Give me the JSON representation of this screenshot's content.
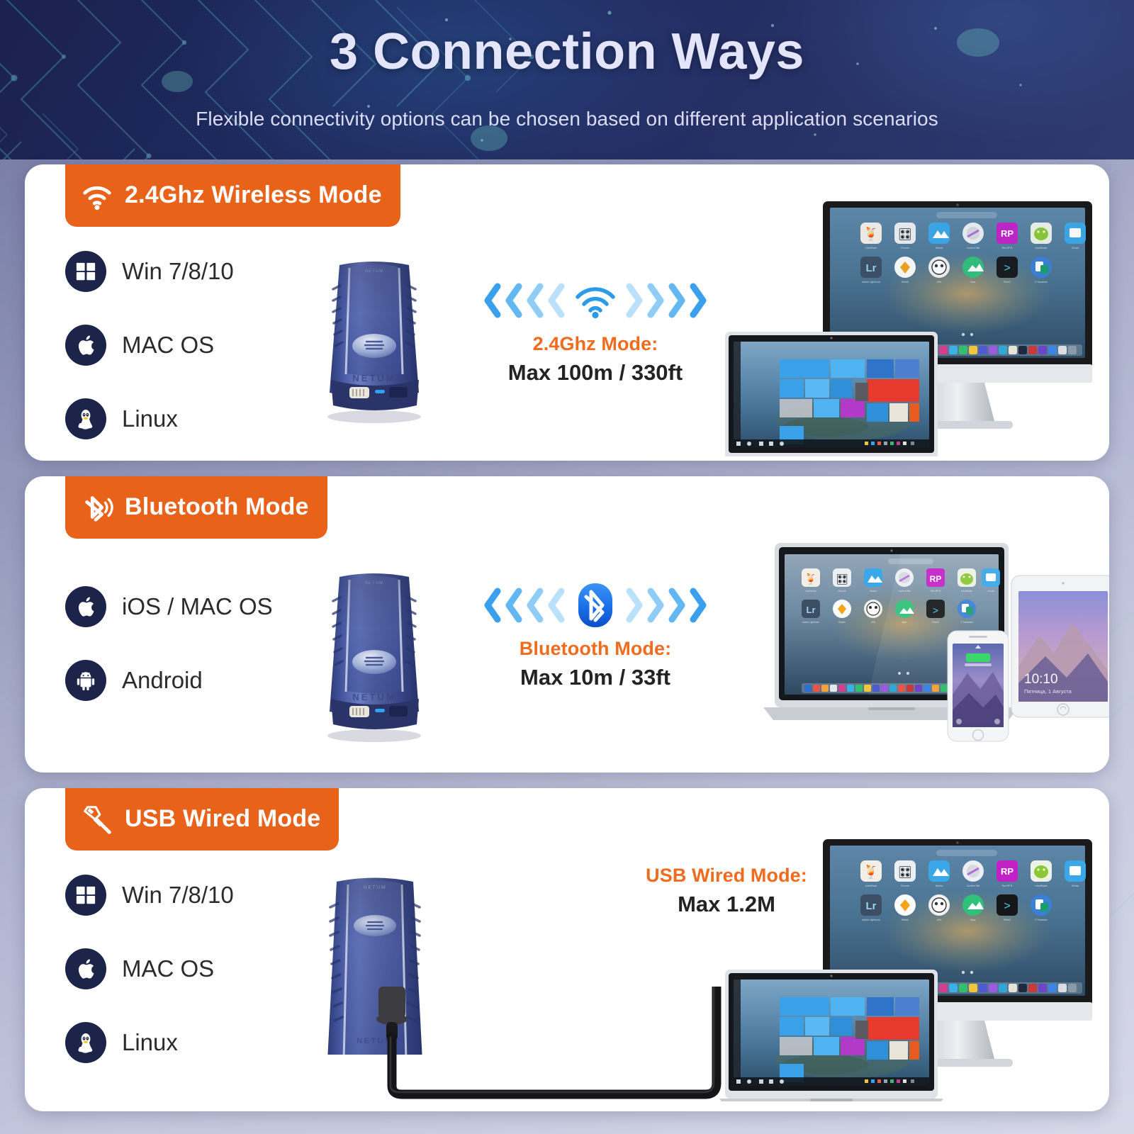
{
  "header": {
    "title": "3 Connection Ways",
    "subtitle": "Flexible connectivity options can be chosen based on different application scenarios"
  },
  "theme": {
    "badge_orange": "#e8621a",
    "caption_orange": "#ef6c1f",
    "os_circle_navy": "#1d2449",
    "chevron_blue": "#3aa0ee",
    "bluetooth_blue": "#1877e8",
    "header_navy": "#232c62"
  },
  "cards": [
    {
      "id": "wireless",
      "badge_label": "2.4Ghz Wireless Mode",
      "badge_icon": "wifi-icon",
      "os_items": [
        {
          "icon": "windows-icon",
          "label": "Win 7/8/10"
        },
        {
          "icon": "apple-icon",
          "label": "MAC OS"
        },
        {
          "icon": "linux-icon",
          "label": "Linux"
        }
      ],
      "signal_icon": "wifi-signal-icon",
      "mode_caption": "2.4Ghz Mode:",
      "mode_range": "Max 100m / 330ft",
      "device_images": [
        "imac-macos-launchpad",
        "macbook-windows10-start"
      ]
    },
    {
      "id": "bluetooth",
      "badge_label": "Bluetooth Mode",
      "badge_icon": "bluetooth-icon",
      "os_items": [
        {
          "icon": "apple-icon",
          "label": "iOS / MAC OS"
        },
        {
          "icon": "android-icon",
          "label": "Android"
        }
      ],
      "signal_icon": "bluetooth-badge-icon",
      "mode_caption": "Bluetooth Mode:",
      "mode_range": "Max 10m / 33ft",
      "device_images": [
        "macbook-macos-launchpad",
        "iphone",
        "ipad-yosemite"
      ],
      "ipad_lockscreen": {
        "time": "10:10",
        "date": "Пятница, 1 Августа"
      }
    },
    {
      "id": "usb",
      "badge_label": "USB Wired Mode",
      "badge_icon": "usb-plug-icon",
      "os_items": [
        {
          "icon": "windows-icon",
          "label": "Win 7/8/10"
        },
        {
          "icon": "apple-icon",
          "label": "MAC OS"
        },
        {
          "icon": "linux-icon",
          "label": "Linux"
        }
      ],
      "mode_caption": "USB Wired Mode:",
      "mode_range": "Max 1.2M",
      "device_images": [
        "imac-macos-launchpad",
        "macbook-windows10-start"
      ],
      "cable": "usb-cable"
    }
  ],
  "product": {
    "name": "barcode-scanner",
    "brand_mark": "NETUM"
  }
}
